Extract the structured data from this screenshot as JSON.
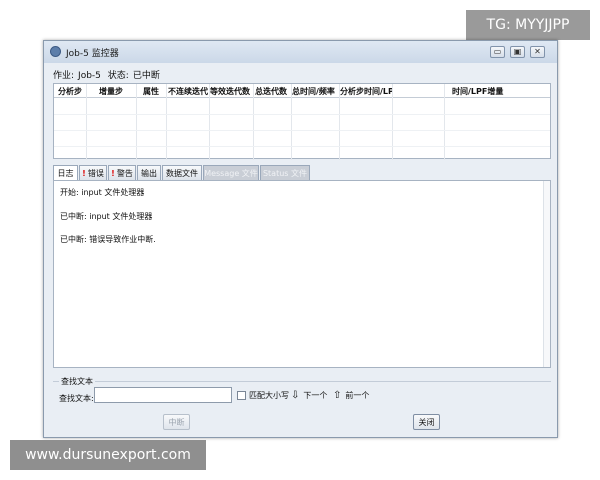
{
  "watermarks": {
    "top": "TG: MYYJJPP",
    "bottom": "www.dursunexport.com"
  },
  "window": {
    "title": "Job-5 监控器",
    "controls": {
      "minimize": "▭",
      "maximize": "▣",
      "close": "✕"
    }
  },
  "info": {
    "job_label": "作业:",
    "job_value": "Job-5",
    "status_label": "状态:",
    "status_value": "已中断"
  },
  "table": {
    "columns": [
      "分析步",
      "增量步",
      "属性",
      "不连续迭代",
      "等效迭代数",
      "总迭代数",
      "总时间/频率",
      "分析步时间/LPF",
      "时间/LPF增量"
    ]
  },
  "tabs": [
    {
      "label": "日志",
      "warn": false,
      "active": true,
      "disabled": false
    },
    {
      "label": "错误",
      "warn": true,
      "active": false,
      "disabled": false
    },
    {
      "label": "警告",
      "warn": true,
      "active": false,
      "disabled": false
    },
    {
      "label": "输出",
      "warn": false,
      "active": false,
      "disabled": false
    },
    {
      "label": "数据文件",
      "warn": false,
      "active": false,
      "disabled": false
    },
    {
      "label": "Message 文件",
      "warn": false,
      "active": false,
      "disabled": true
    },
    {
      "label": "Status 文件",
      "warn": false,
      "active": false,
      "disabled": true
    }
  ],
  "log": [
    "开始:  input 文件处理器",
    "已中断:  input 文件处理器",
    "已中断:  错误导致作业中断."
  ],
  "find": {
    "section_label": "查找文本",
    "text_label": "查找文本:",
    "input_value": "",
    "match_case": "匹配大小写",
    "next": "下一个",
    "prev": "前一个"
  },
  "buttons": {
    "interrupt": "中断",
    "close": "关闭"
  }
}
